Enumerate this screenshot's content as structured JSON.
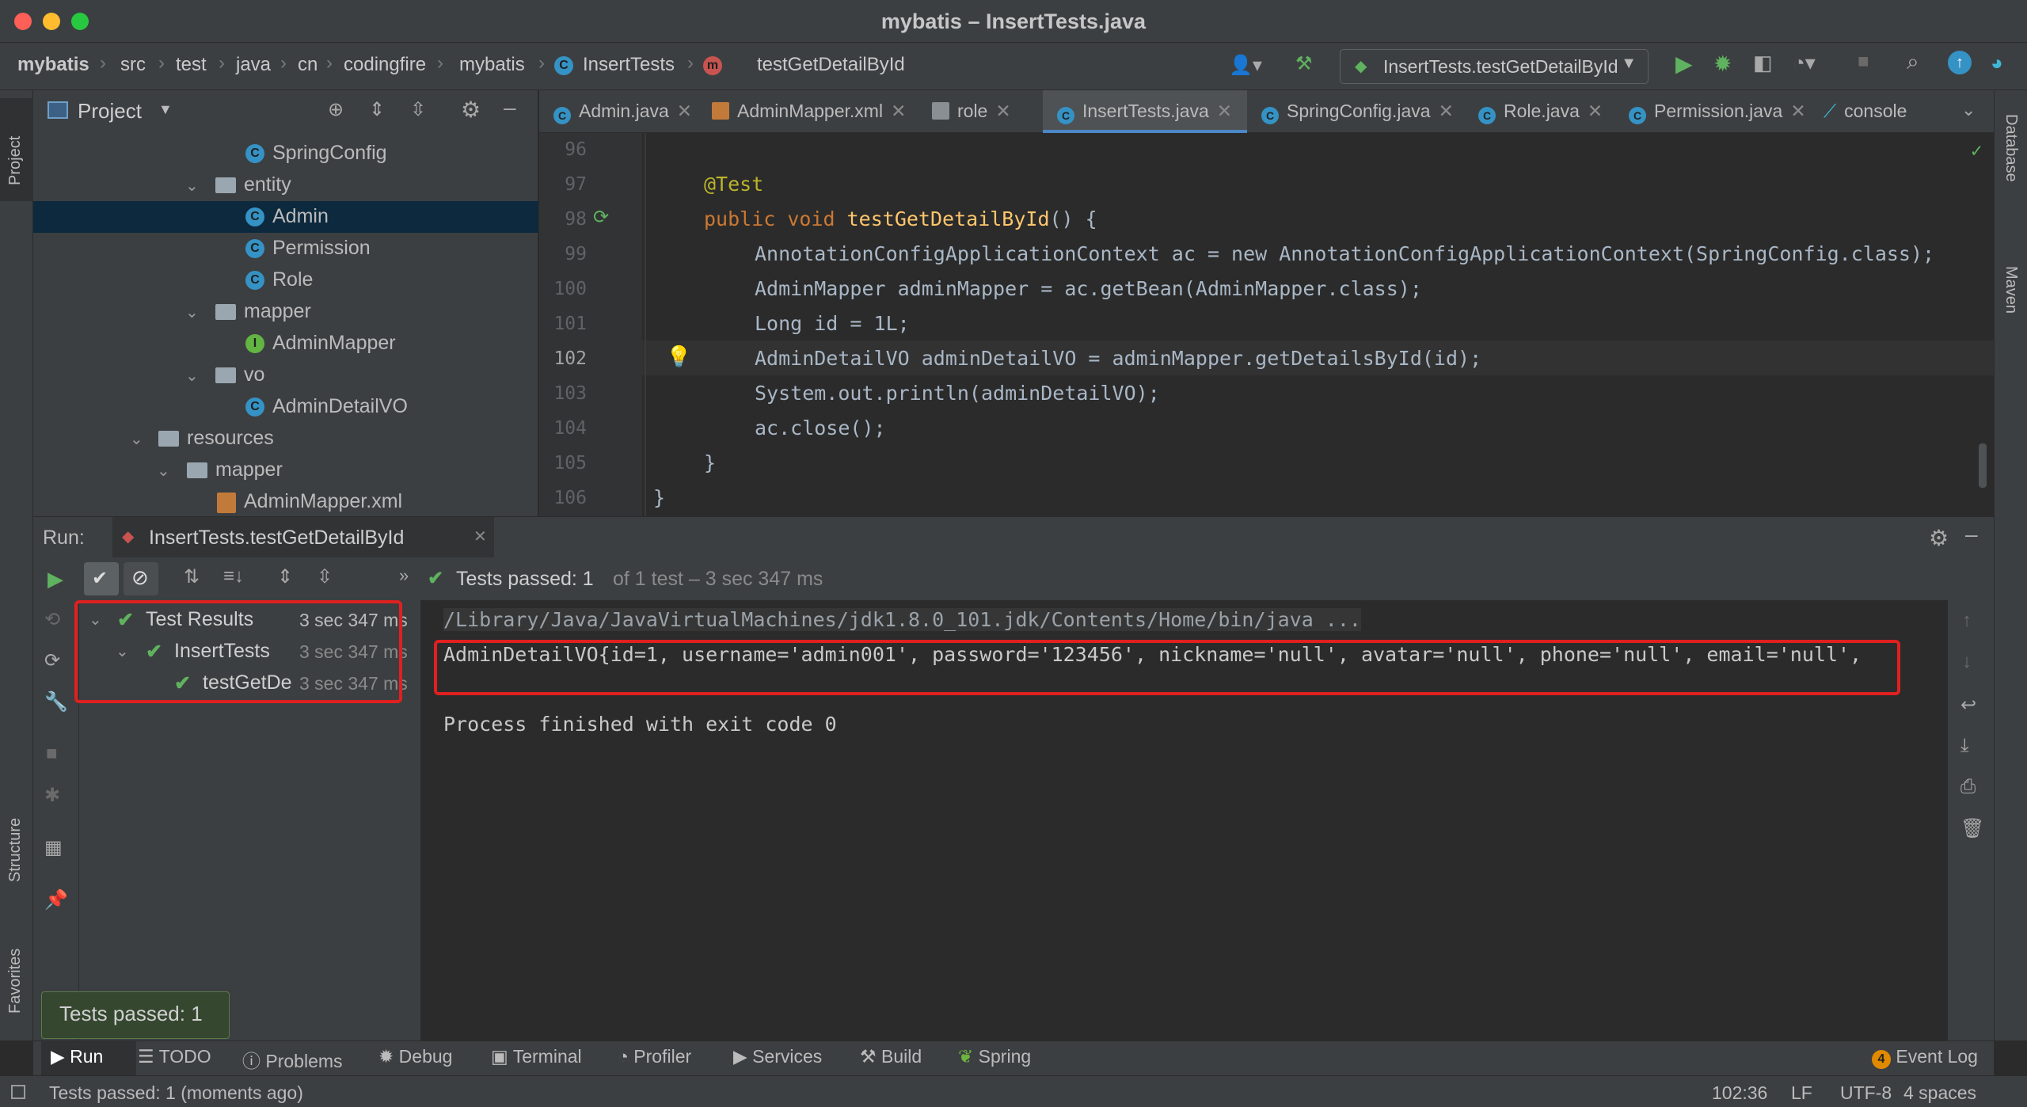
{
  "window": {
    "title": "mybatis – InsertTests.java"
  },
  "breadcrumbs": [
    "mybatis",
    "src",
    "test",
    "java",
    "cn",
    "codingfire",
    "mybatis",
    "InsertTests",
    "testGetDetailById"
  ],
  "run_config": {
    "label": "InsertTests.testGetDetailById"
  },
  "project_panel": {
    "title": "Project",
    "tree": [
      {
        "label": "SpringConfig",
        "kind": "class"
      },
      {
        "label": "entity",
        "kind": "folder"
      },
      {
        "label": "Admin",
        "kind": "class",
        "selected": true
      },
      {
        "label": "Permission",
        "kind": "class"
      },
      {
        "label": "Role",
        "kind": "class"
      },
      {
        "label": "mapper",
        "kind": "folder"
      },
      {
        "label": "AdminMapper",
        "kind": "interface"
      },
      {
        "label": "vo",
        "kind": "folder"
      },
      {
        "label": "AdminDetailVO",
        "kind": "class"
      },
      {
        "label": "resources",
        "kind": "folder"
      },
      {
        "label": "mapper",
        "kind": "folder"
      },
      {
        "label": "AdminMapper.xml",
        "kind": "xml"
      }
    ]
  },
  "editor_tabs": [
    {
      "label": "Admin.java"
    },
    {
      "label": "AdminMapper.xml"
    },
    {
      "label": "role"
    },
    {
      "label": "InsertTests.java",
      "active": true
    },
    {
      "label": "SpringConfig.java"
    },
    {
      "label": "Role.java"
    },
    {
      "label": "Permission.java"
    },
    {
      "label": "console"
    }
  ],
  "editor": {
    "current_line": 102,
    "lines": [
      {
        "n": "96",
        "code": ""
      },
      {
        "n": "97",
        "code": "@Test"
      },
      {
        "n": "98",
        "code": "public void testGetDetailById() {"
      },
      {
        "n": "99",
        "code": "AnnotationConfigApplicationContext ac = new AnnotationConfigApplicationContext(SpringConfig.class);"
      },
      {
        "n": "100",
        "code": "AdminMapper adminMapper = ac.getBean(AdminMapper.class);"
      },
      {
        "n": "101",
        "code": "Long id = 1L;"
      },
      {
        "n": "102",
        "code": "AdminDetailVO adminDetailVO = adminMapper.getDetailsById(id);"
      },
      {
        "n": "103",
        "code": "System.out.println(adminDetailVO);"
      },
      {
        "n": "104",
        "code": "ac.close();"
      },
      {
        "n": "105",
        "code": "}"
      },
      {
        "n": "106",
        "code": "}"
      }
    ]
  },
  "run_panel": {
    "label": "Run:",
    "tab": "InsertTests.testGetDetailById",
    "status_bold": "Tests passed: 1",
    "status_rest": "of 1 test – 3 sec 347 ms",
    "test_tree": [
      {
        "label": "Test Results",
        "time": "3 sec 347 ms"
      },
      {
        "label": "InsertTests",
        "time": "3 sec 347 ms"
      },
      {
        "label": "testGetDe",
        "time": "3 sec 347 ms"
      }
    ],
    "console": [
      "/Library/Java/JavaVirtualMachines/jdk1.8.0_101.jdk/Contents/Home/bin/java ...",
      "AdminDetailVO{id=1, username='admin001', password='123456', nickname='null', avatar='null', phone='null', email='null',",
      "",
      "Process finished with exit code 0"
    ]
  },
  "tooltip": "Tests passed: 1",
  "left_stripe": {
    "project": "Project",
    "structure": "Structure",
    "favorites": "Favorites"
  },
  "right_stripe": {
    "database": "Database",
    "maven": "Maven"
  },
  "bottom_tabs": [
    "Run",
    "TODO",
    "Problems",
    "Debug",
    "Terminal",
    "Profiler",
    "Services",
    "Build",
    "Spring"
  ],
  "event_log": {
    "count": "4",
    "label": "Event Log"
  },
  "statusbar": {
    "message": "Tests passed: 1 (moments ago)",
    "position": "102:36",
    "line_sep": "LF",
    "encoding": "UTF-8",
    "indent": "4 spaces"
  },
  "colors": {
    "accent": "#4a88c7",
    "pass": "#5fb25f",
    "highlight_box": "#e02020"
  }
}
